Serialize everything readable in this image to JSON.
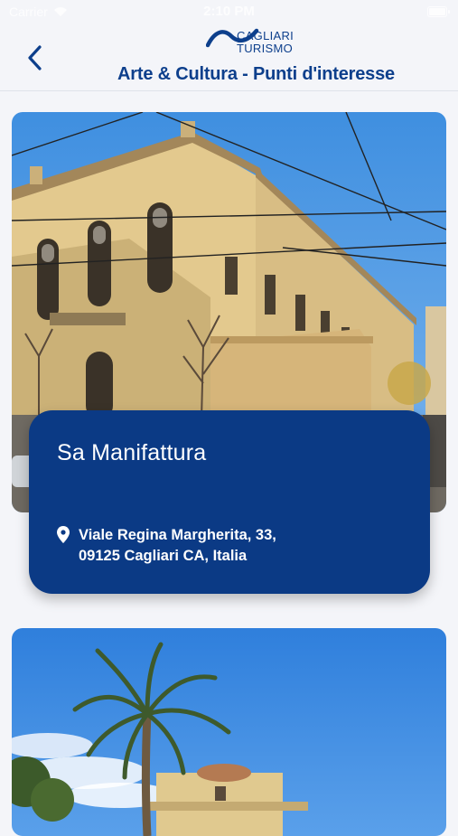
{
  "status_bar": {
    "carrier": "Carrier",
    "time": "2:10 PM"
  },
  "header": {
    "logo_line1": "CAGLIARI",
    "logo_line2": "TURISMO",
    "title": "Arte & Cultura - Punti d'interesse"
  },
  "places": [
    {
      "name": "Sa Manifattura",
      "address_line1": "Viale Regina Margherita, 33,",
      "address_line2": "09125 Cagliari CA, Italia"
    }
  ],
  "colors": {
    "brand_blue": "#0b3a85",
    "title_blue": "#0d3f8c",
    "background": "#f4f5f9"
  },
  "icons": [
    "wifi-icon",
    "battery-icon",
    "back-chevron-icon",
    "logo-wave-icon",
    "location-pin-icon"
  ]
}
